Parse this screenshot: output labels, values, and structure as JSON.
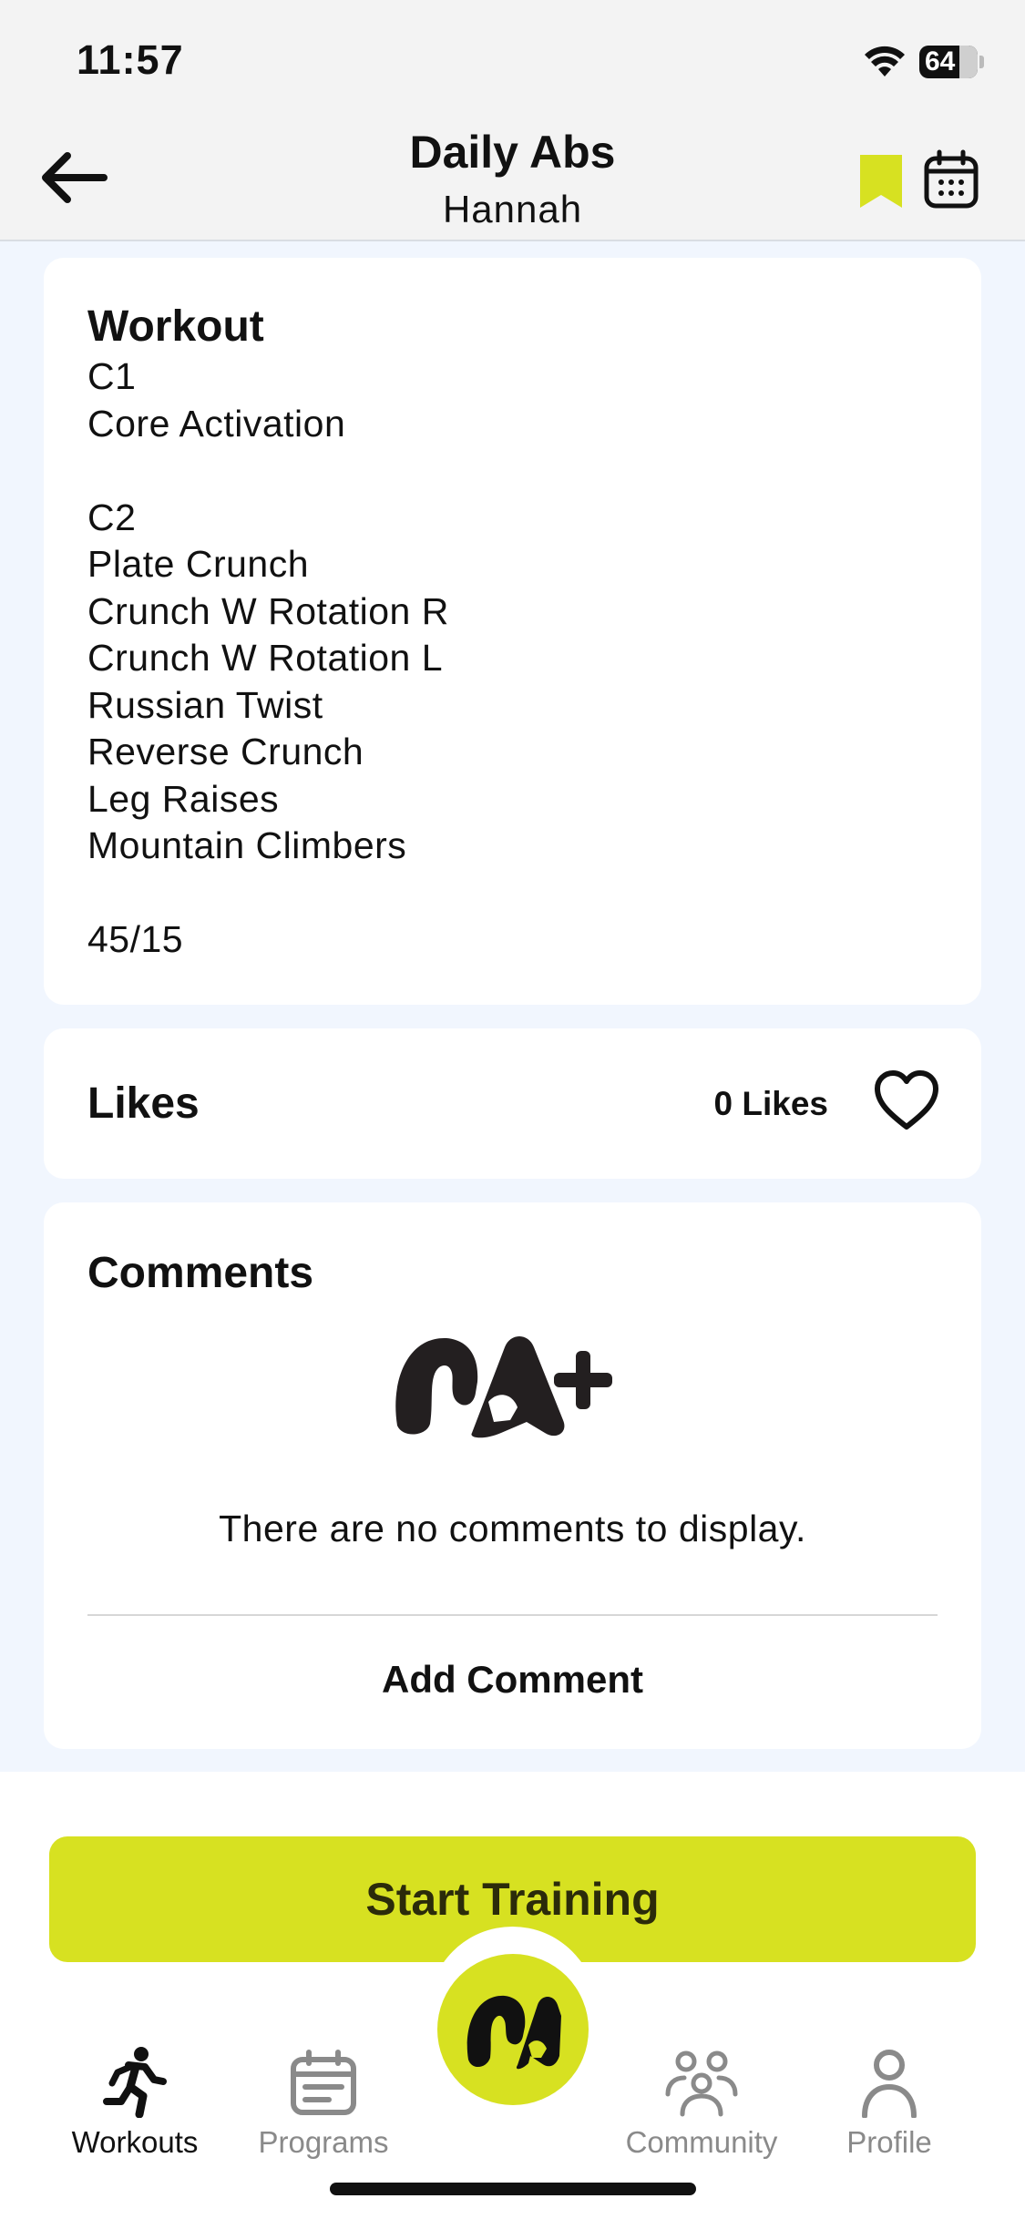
{
  "status_bar": {
    "time": "11:57",
    "battery": "64"
  },
  "header": {
    "title": "Daily Abs",
    "subtitle": "Hannah"
  },
  "workout": {
    "title": "Workout",
    "lines": [
      "C1",
      "Core Activation",
      "",
      "C2",
      "Plate Crunch",
      "Crunch W Rotation R",
      "Crunch W Rotation L",
      "Russian Twist",
      "Reverse Crunch",
      "Leg Raises",
      "Mountain Climbers",
      "",
      "45/15"
    ]
  },
  "likes": {
    "title": "Likes",
    "count_label": "0 Likes"
  },
  "comments": {
    "title": "Comments",
    "empty_text": "There are no comments to display.",
    "add_label": "Add Comment"
  },
  "start_button": {
    "label": "Start Training"
  },
  "nav": {
    "items": [
      {
        "label": "Workouts",
        "icon": "running-person-icon",
        "active": true
      },
      {
        "label": "Programs",
        "icon": "calendar-list-icon",
        "active": false
      },
      {
        "label": "Community",
        "icon": "people-group-icon",
        "active": false
      },
      {
        "label": "Profile",
        "icon": "person-icon",
        "active": false
      }
    ]
  },
  "colors": {
    "accent": "#d7e121",
    "background": "#f1f6fe",
    "card": "#ffffff",
    "inactive": "#8a8a8a"
  }
}
